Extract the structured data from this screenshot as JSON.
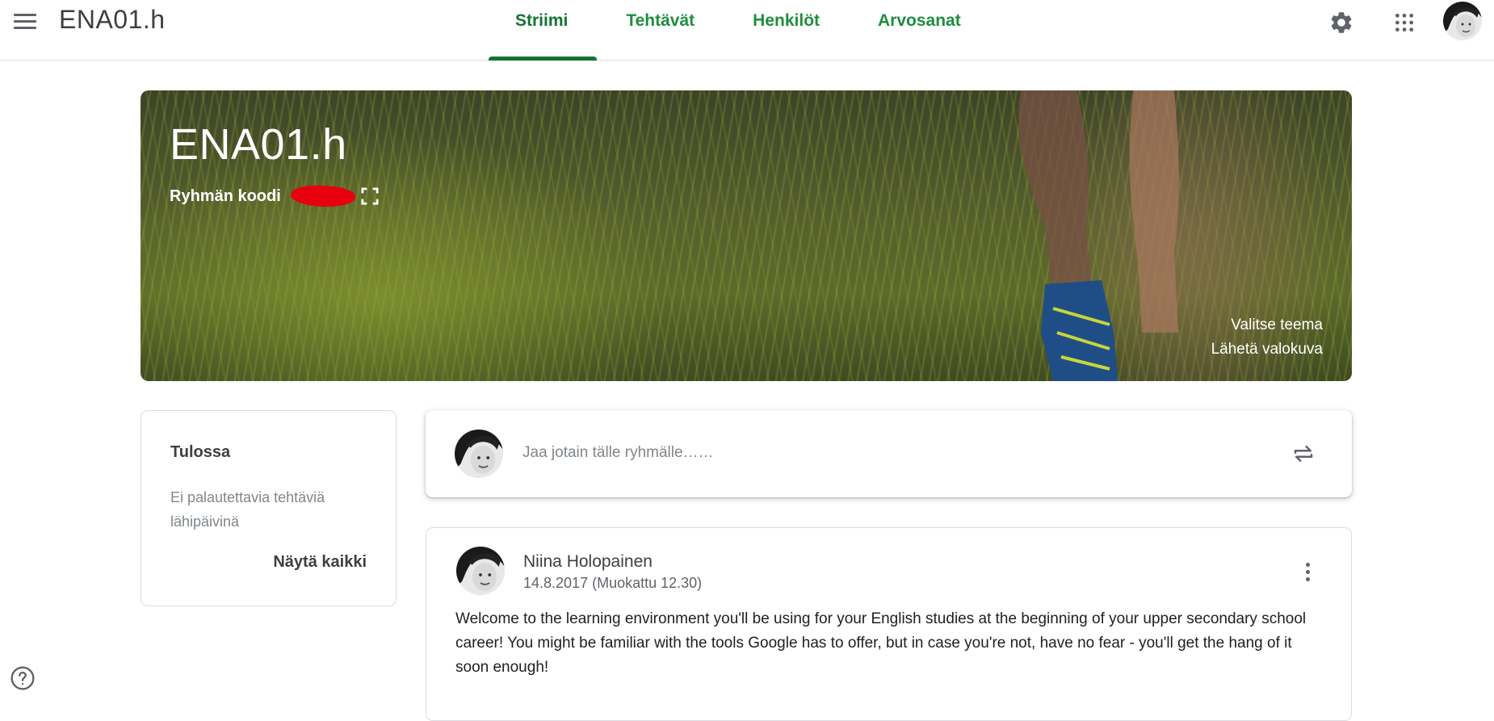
{
  "header": {
    "title": "ENA01.h",
    "tabs": [
      {
        "label": "Striimi",
        "active": true
      },
      {
        "label": "Tehtävät",
        "active": false
      },
      {
        "label": "Henkilöt",
        "active": false
      },
      {
        "label": "Arvosanat",
        "active": false
      }
    ],
    "icons": [
      "menu-icon",
      "settings-gear-icon",
      "apps-grid-icon",
      "account-avatar"
    ]
  },
  "banner": {
    "title": "ENA01.h",
    "class_code_label": "Ryhmän koodi",
    "select_theme": "Valitse teema",
    "upload_photo": "Lähetä valokuva"
  },
  "upcoming": {
    "title": "Tulossa",
    "message": "Ei palautettavia tehtäviä lähipäivinä",
    "view_all": "Näytä kaikki"
  },
  "share": {
    "placeholder": "Jaa jotain tälle ryhmälle……"
  },
  "post": {
    "author": "Niina Holopainen",
    "date": "14.8.2017 (Muokattu 12.30)",
    "body": "Welcome to the learning environment you'll be using for your English studies at the beginning of your upper secondary school career! You might be familiar with the tools Google has to offer, but in case you're not, have no fear - you'll get the hang of it soon enough!"
  },
  "colors": {
    "accent_green": "#137333",
    "tab_green": "#1e8e3e",
    "redaction": "#e8000d"
  }
}
